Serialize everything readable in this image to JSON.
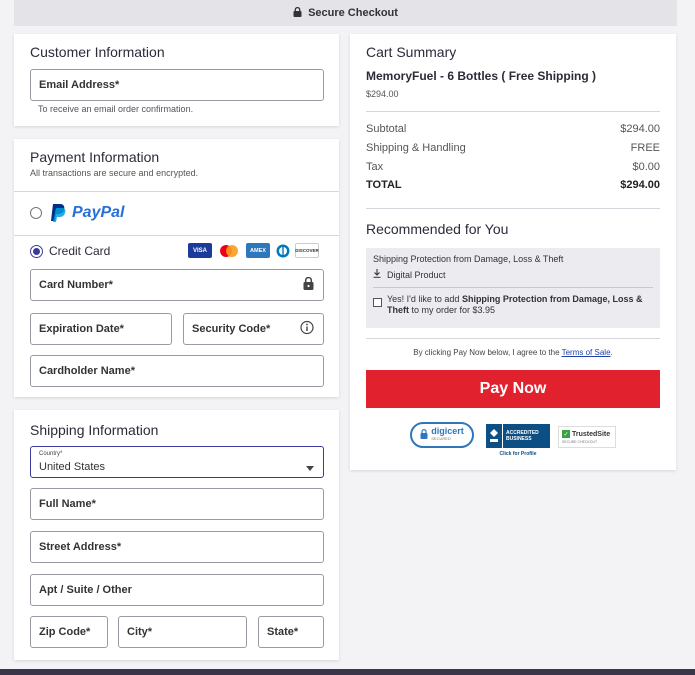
{
  "header": {
    "title": "Secure Checkout"
  },
  "customer": {
    "title": "Customer Information",
    "email_label": "Email Address*",
    "email_hint": "To receive an email order confirmation."
  },
  "payment": {
    "title": "Payment Information",
    "subtitle": "All transactions are secure and encrypted.",
    "paypal_label": "PayPal",
    "credit_card_label": "Credit Card",
    "card_logos": [
      "VISA",
      "mastercard",
      "AMEX",
      "diners",
      "DISCOVER"
    ],
    "card_number_label": "Card Number*",
    "expiration_label": "Expiration Date*",
    "security_label": "Security Code*",
    "cardholder_label": "Cardholder Name*"
  },
  "shipping": {
    "title": "Shipping Information",
    "country_label": "Country*",
    "country_value": "United States",
    "full_name_label": "Full Name*",
    "street_label": "Street Address*",
    "apt_label": "Apt / Suite / Other",
    "zip_label": "Zip Code*",
    "city_label": "City*",
    "state_label": "State*"
  },
  "cart": {
    "title": "Cart Summary",
    "product_name": "MemoryFuel - 6 Bottles ( Free Shipping )",
    "product_price": "$294.00",
    "rows": [
      {
        "label": "Subtotal",
        "value": "$294.00"
      },
      {
        "label": "Shipping & Handling",
        "value": "FREE"
      },
      {
        "label": "Tax",
        "value": "$0.00"
      },
      {
        "label": "TOTAL",
        "value": "$294.00"
      }
    ],
    "recommended_title": "Recommended for You",
    "rec_product_title": "Shipping Protection from Damage, Loss & Theft",
    "rec_product_type": "Digital Product",
    "rec_checkbox_prefix": "Yes! I'd like to add ",
    "rec_checkbox_bold": "Shipping Protection from Damage, Loss & Theft",
    "rec_checkbox_suffix": " to my order for $3.95",
    "terms_prefix": "By clicking Pay Now below, I agree to the ",
    "terms_link": "Terms of Sale",
    "terms_suffix": ".",
    "pay_button": "Pay Now"
  },
  "trust": {
    "digicert": "digicert",
    "digicert_sub": "SECURED",
    "bbb_line1": "ACCREDITED",
    "bbb_line2": "BUSINESS",
    "bbb_caption": "Click for Profile",
    "trustedsite": "TrustedSite",
    "trustedsite_sub": "SECURE CHECKOUT"
  },
  "colors": {
    "accent": "#3b3b9e",
    "pay": "#e1222e",
    "paypal_dark": "#003087",
    "paypal_light": "#009cde"
  }
}
